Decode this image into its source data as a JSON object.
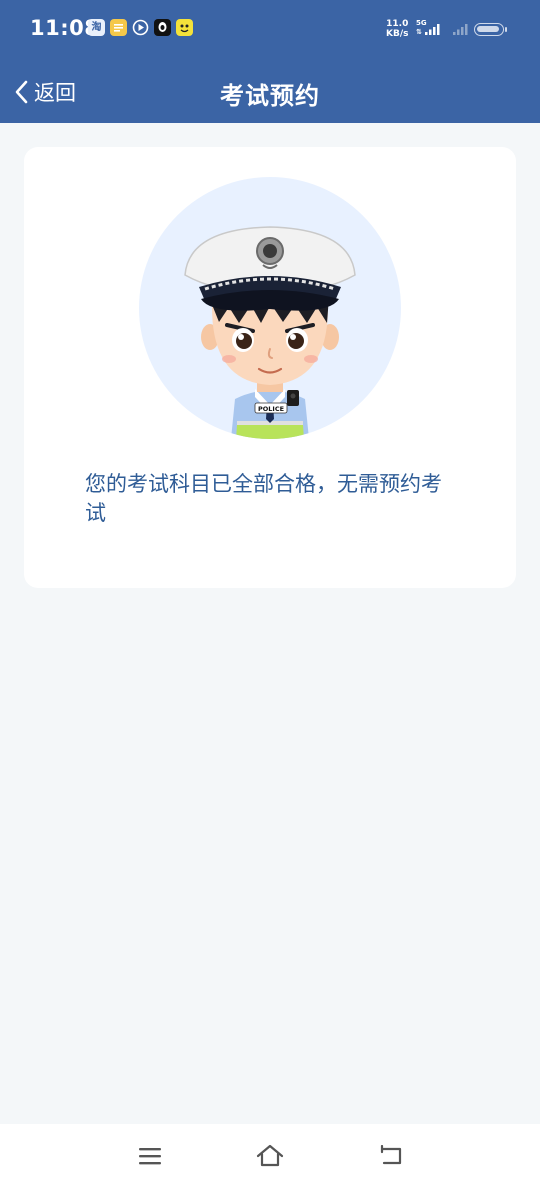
{
  "status_bar": {
    "time": "11:08",
    "net_speed_value": "11.0",
    "net_speed_unit": "KB/s",
    "network_type": "5G",
    "app_icons": [
      "taobao-icon",
      "notes-icon",
      "video-icon",
      "qq-icon",
      "mini-app-icon"
    ],
    "icon_labels": {
      "taobao": "淘"
    }
  },
  "header": {
    "back_label": "返回",
    "title": "考试预约"
  },
  "card": {
    "message": "您的考试科目已全部合格，无需预约考试",
    "badge_text": "POLICE"
  },
  "colors": {
    "primary": "#3b64a5",
    "background": "#f4f7f9",
    "message_text": "#2f5c96",
    "avatar_circle": "#e8f1ff"
  }
}
